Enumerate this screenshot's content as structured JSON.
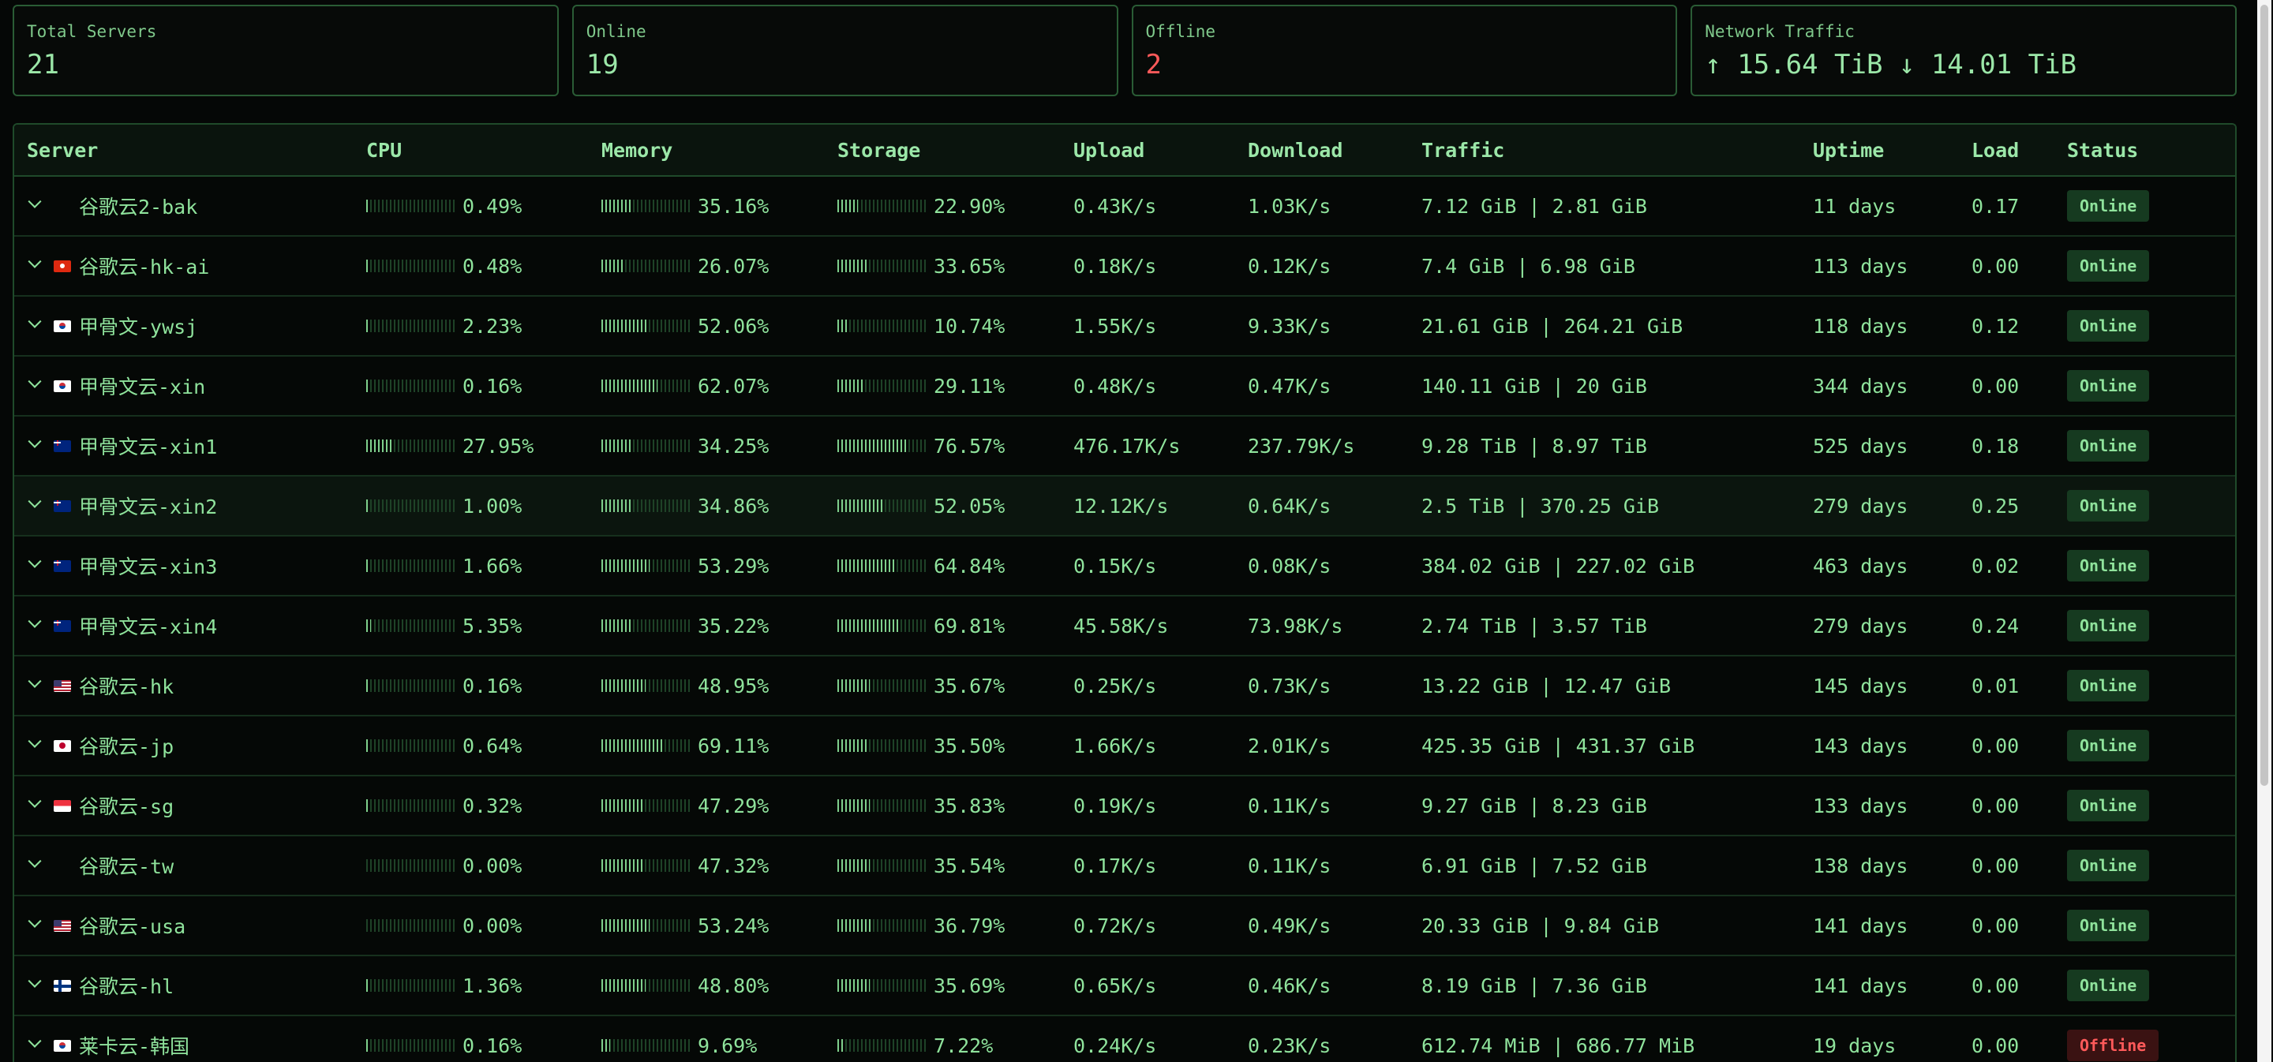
{
  "stats": {
    "total": {
      "label": "Total Servers",
      "value": "21"
    },
    "online": {
      "label": "Online",
      "value": "19"
    },
    "offline": {
      "label": "Offline",
      "value": "2"
    },
    "traffic": {
      "label": "Network Traffic",
      "value": "↑ 15.64 TiB ↓ 14.01 TiB"
    }
  },
  "table": {
    "headers": {
      "server": "Server",
      "cpu": "CPU",
      "memory": "Memory",
      "storage": "Storage",
      "upload": "Upload",
      "download": "Download",
      "traffic": "Traffic",
      "uptime": "Uptime",
      "load": "Load",
      "status": "Status"
    },
    "rows": [
      {
        "name": "谷歌云2-bak",
        "flag": "none",
        "cpu": "0.49%",
        "memory": "35.16%",
        "storage": "22.90%",
        "upload": "0.43K/s",
        "download": "1.03K/s",
        "traffic": "7.12 GiB | 2.81 GiB",
        "uptime": "11 days",
        "load": "0.17",
        "status": "Online"
      },
      {
        "name": "谷歌云-hk-ai",
        "flag": "hk",
        "cpu": "0.48%",
        "memory": "26.07%",
        "storage": "33.65%",
        "upload": "0.18K/s",
        "download": "0.12K/s",
        "traffic": "7.4 GiB | 6.98 GiB",
        "uptime": "113 days",
        "load": "0.00",
        "status": "Online"
      },
      {
        "name": "甲骨文-ywsj",
        "flag": "kr",
        "cpu": "2.23%",
        "memory": "52.06%",
        "storage": "10.74%",
        "upload": "1.55K/s",
        "download": "9.33K/s",
        "traffic": "21.61 GiB | 264.21 GiB",
        "uptime": "118 days",
        "load": "0.12",
        "status": "Online"
      },
      {
        "name": "甲骨文云-xin",
        "flag": "kr",
        "cpu": "0.16%",
        "memory": "62.07%",
        "storage": "29.11%",
        "upload": "0.48K/s",
        "download": "0.47K/s",
        "traffic": "140.11 GiB | 20 GiB",
        "uptime": "344 days",
        "load": "0.00",
        "status": "Online"
      },
      {
        "name": "甲骨文云-xin1",
        "flag": "au",
        "cpu": "27.95%",
        "memory": "34.25%",
        "storage": "76.57%",
        "upload": "476.17K/s",
        "download": "237.79K/s",
        "traffic": "9.28 TiB | 8.97 TiB",
        "uptime": "525 days",
        "load": "0.18",
        "status": "Online"
      },
      {
        "name": "甲骨文云-xin2",
        "flag": "au",
        "cpu": "1.00%",
        "memory": "34.86%",
        "storage": "52.05%",
        "upload": "12.12K/s",
        "download": "0.64K/s",
        "traffic": "2.5 TiB | 370.25 GiB",
        "uptime": "279 days",
        "load": "0.25",
        "status": "Online"
      },
      {
        "name": "甲骨文云-xin3",
        "flag": "au",
        "cpu": "1.66%",
        "memory": "53.29%",
        "storage": "64.84%",
        "upload": "0.15K/s",
        "download": "0.08K/s",
        "traffic": "384.02 GiB | 227.02 GiB",
        "uptime": "463 days",
        "load": "0.02",
        "status": "Online"
      },
      {
        "name": "甲骨文云-xin4",
        "flag": "au",
        "cpu": "5.35%",
        "memory": "35.22%",
        "storage": "69.81%",
        "upload": "45.58K/s",
        "download": "73.98K/s",
        "traffic": "2.74 TiB | 3.57 TiB",
        "uptime": "279 days",
        "load": "0.24",
        "status": "Online"
      },
      {
        "name": "谷歌云-hk",
        "flag": "us",
        "cpu": "0.16%",
        "memory": "48.95%",
        "storage": "35.67%",
        "upload": "0.25K/s",
        "download": "0.73K/s",
        "traffic": "13.22 GiB | 12.47 GiB",
        "uptime": "145 days",
        "load": "0.01",
        "status": "Online"
      },
      {
        "name": "谷歌云-jp",
        "flag": "jp",
        "cpu": "0.64%",
        "memory": "69.11%",
        "storage": "35.50%",
        "upload": "1.66K/s",
        "download": "2.01K/s",
        "traffic": "425.35 GiB | 431.37 GiB",
        "uptime": "143 days",
        "load": "0.00",
        "status": "Online"
      },
      {
        "name": "谷歌云-sg",
        "flag": "sg",
        "cpu": "0.32%",
        "memory": "47.29%",
        "storage": "35.83%",
        "upload": "0.19K/s",
        "download": "0.11K/s",
        "traffic": "9.27 GiB | 8.23 GiB",
        "uptime": "133 days",
        "load": "0.00",
        "status": "Online"
      },
      {
        "name": "谷歌云-tw",
        "flag": "none",
        "cpu": "0.00%",
        "memory": "47.32%",
        "storage": "35.54%",
        "upload": "0.17K/s",
        "download": "0.11K/s",
        "traffic": "6.91 GiB | 7.52 GiB",
        "uptime": "138 days",
        "load": "0.00",
        "status": "Online"
      },
      {
        "name": "谷歌云-usa",
        "flag": "us",
        "cpu": "0.00%",
        "memory": "53.24%",
        "storage": "36.79%",
        "upload": "0.72K/s",
        "download": "0.49K/s",
        "traffic": "20.33 GiB | 9.84 GiB",
        "uptime": "141 days",
        "load": "0.00",
        "status": "Online"
      },
      {
        "name": "谷歌云-hl",
        "flag": "fi",
        "cpu": "1.36%",
        "memory": "48.80%",
        "storage": "35.69%",
        "upload": "0.65K/s",
        "download": "0.46K/s",
        "traffic": "8.19 GiB | 7.36 GiB",
        "uptime": "141 days",
        "load": "0.00",
        "status": "Online"
      },
      {
        "name": "莱卡云-韩国",
        "flag": "kr",
        "cpu": "0.16%",
        "memory": "9.69%",
        "storage": "7.22%",
        "upload": "0.24K/s",
        "download": "0.23K/s",
        "traffic": "612.74 MiB | 686.77 MiB",
        "uptime": "19 days",
        "load": "0.00",
        "status": "Offline"
      }
    ]
  }
}
